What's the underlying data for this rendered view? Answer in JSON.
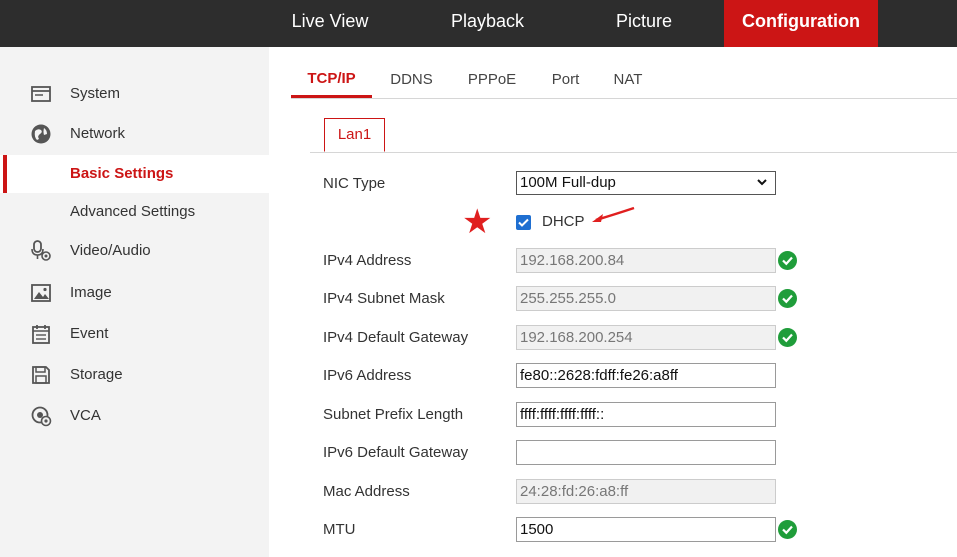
{
  "top_nav": {
    "tabs": [
      "Live View",
      "Playback",
      "Picture",
      "Configuration"
    ],
    "active": "Configuration"
  },
  "sidebar": {
    "items": [
      {
        "label": "System",
        "icon": "system-icon"
      },
      {
        "label": "Network",
        "icon": "network-icon"
      },
      {
        "label": "Basic Settings"
      },
      {
        "label": "Advanced Settings"
      },
      {
        "label": "Video/Audio",
        "icon": "video-audio-icon"
      },
      {
        "label": "Image",
        "icon": "image-icon"
      },
      {
        "label": "Event",
        "icon": "event-icon"
      },
      {
        "label": "Storage",
        "icon": "storage-icon"
      },
      {
        "label": "VCA",
        "icon": "vca-icon"
      }
    ],
    "active": "Basic Settings"
  },
  "sub_tabs": {
    "tabs": [
      "TCP/IP",
      "DDNS",
      "PPPoE",
      "Port",
      "NAT"
    ],
    "active": "TCP/IP"
  },
  "lan_tab": "Lan1",
  "form": {
    "nic_type": {
      "label": "NIC Type",
      "value": "100M Full-dup"
    },
    "dhcp": {
      "label": "DHCP",
      "checked": true
    },
    "ipv4_address": {
      "label": "IPv4 Address",
      "value": "192.168.200.84"
    },
    "ipv4_mask": {
      "label": "IPv4 Subnet Mask",
      "value": "255.255.255.0"
    },
    "ipv4_gateway": {
      "label": "IPv4 Default Gateway",
      "value": "192.168.200.254"
    },
    "ipv6_address": {
      "label": "IPv6 Address",
      "value": "fe80::2628:fdff:fe26:a8ff"
    },
    "subnet_prefix": {
      "label": "Subnet Prefix Length",
      "value": "ffff:ffff:ffff:ffff::"
    },
    "ipv6_gateway": {
      "label": "IPv6 Default Gateway",
      "value": ""
    },
    "mac_address": {
      "label": "Mac Address",
      "value": "24:28:fd:26:a8:ff"
    },
    "mtu": {
      "label": "MTU",
      "value": "1500"
    }
  },
  "colors": {
    "accent": "#cc1515",
    "topbar": "#2d2d2d",
    "sidebar": "#f3f3f3",
    "ok_green": "#1f9d3a",
    "checkbox": "#1f6fd1",
    "annotation": "#e01f1f"
  },
  "annotations": {
    "star": "★"
  }
}
